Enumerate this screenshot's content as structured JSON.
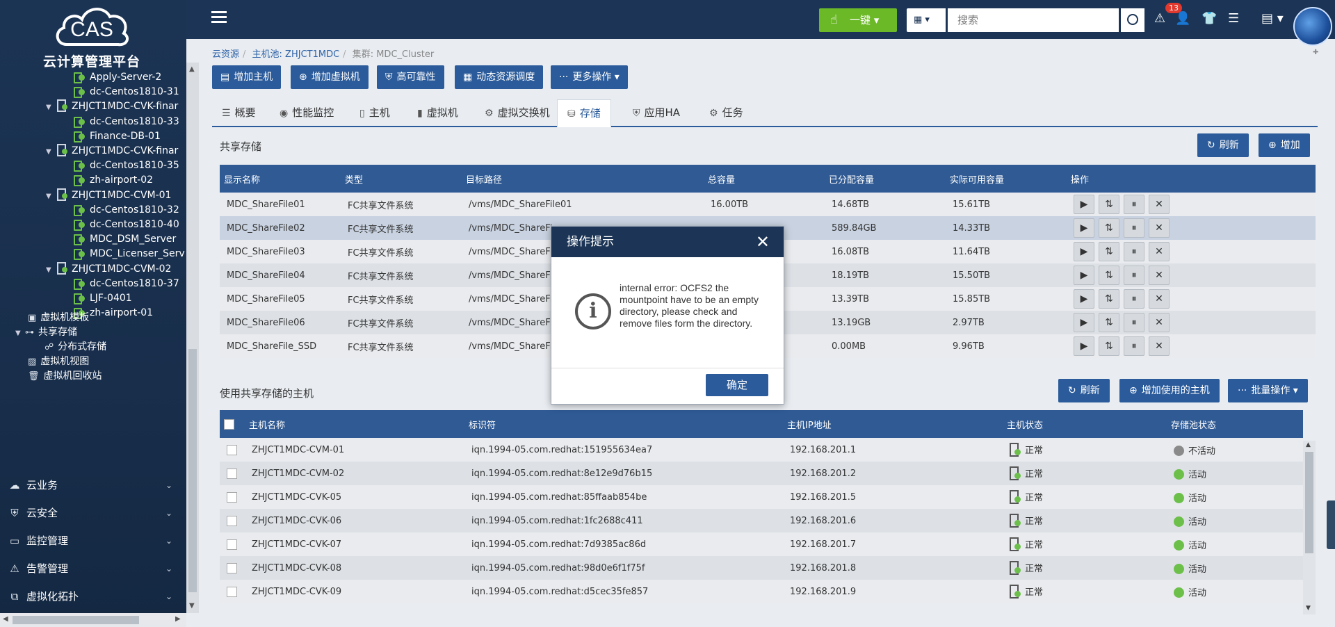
{
  "brand": {
    "logo_text": "CAS",
    "title": "云计算管理平台"
  },
  "tree": [
    {
      "label": "Apply-Server-2",
      "type": "vm",
      "indent": 2
    },
    {
      "label": "dc-Centos1810-31",
      "type": "vm",
      "indent": 2
    },
    {
      "label": "ZHJCT1MDC-CVK-finar",
      "type": "host",
      "indent": 1
    },
    {
      "label": "dc-Centos1810-33",
      "type": "vm",
      "indent": 2
    },
    {
      "label": "Finance-DB-01",
      "type": "vm",
      "indent": 2
    },
    {
      "label": "ZHJCT1MDC-CVK-finar",
      "type": "host",
      "indent": 1
    },
    {
      "label": "dc-Centos1810-35",
      "type": "vm",
      "indent": 2
    },
    {
      "label": "zh-airport-02",
      "type": "vm",
      "indent": 2
    },
    {
      "label": "ZHJCT1MDC-CVM-01",
      "type": "host",
      "indent": 1
    },
    {
      "label": "dc-Centos1810-32",
      "type": "vm",
      "indent": 2
    },
    {
      "label": "dc-Centos1810-40",
      "type": "vm",
      "indent": 2
    },
    {
      "label": "MDC_DSM_Server",
      "type": "vm",
      "indent": 2
    },
    {
      "label": "MDC_Licenser_Serv",
      "type": "vm",
      "indent": 2
    },
    {
      "label": "ZHJCT1MDC-CVM-02",
      "type": "host",
      "indent": 1
    },
    {
      "label": "dc-Centos1810-37",
      "type": "vm",
      "indent": 2
    },
    {
      "label": "LJF-0401",
      "type": "vm",
      "indent": 2
    },
    {
      "label": "zh-airport-01",
      "type": "vm",
      "indent": 2
    }
  ],
  "tree_misc": {
    "vm_template": "虚拟机模板",
    "shared_storage": "共享存储",
    "distributed_storage": "分布式存储",
    "vm_view": "虚拟机视图",
    "vm_recycle": "虚拟机回收站"
  },
  "nav": [
    {
      "label": "云业务",
      "icon": "cloud-icon"
    },
    {
      "label": "云安全",
      "icon": "shield-icon"
    },
    {
      "label": "监控管理",
      "icon": "monitor-icon"
    },
    {
      "label": "告警管理",
      "icon": "alarm-icon"
    },
    {
      "label": "虚拟化拓扑",
      "icon": "topology-icon"
    }
  ],
  "topbar": {
    "onekey": "一键",
    "search_placeholder": "搜索",
    "alert_count": "13"
  },
  "breadcrumb": {
    "root": "云资源",
    "pool": "主机池: ZHJCT1MDC",
    "cluster": "集群: MDC_Cluster"
  },
  "toolbar": {
    "add_host": "增加主机",
    "add_vm": "增加虚拟机",
    "ha": "高可靠性",
    "drs": "动态资源调度",
    "more": "更多操作"
  },
  "tabs": [
    {
      "label": "概要",
      "icon": "list-icon"
    },
    {
      "label": "性能监控",
      "icon": "gauge-icon"
    },
    {
      "label": "主机",
      "icon": "server-icon"
    },
    {
      "label": "虚拟机",
      "icon": "vm-icon"
    },
    {
      "label": "虚拟交换机",
      "icon": "switch-icon"
    },
    {
      "label": "存储",
      "icon": "database-icon"
    },
    {
      "label": "应用HA",
      "icon": "app-ha-icon"
    },
    {
      "label": "任务",
      "icon": "task-icon"
    }
  ],
  "shared": {
    "title": "共享存储",
    "refresh": "刷新",
    "add": "增加",
    "headers": [
      "显示名称",
      "类型",
      "目标路径",
      "总容量",
      "已分配容量",
      "实际可用容量",
      "操作"
    ],
    "rows": [
      [
        "MDC_ShareFile01",
        "FC共享文件系统",
        "/vms/MDC_ShareFile01",
        "16.00TB",
        "14.68TB",
        "15.61TB"
      ],
      [
        "MDC_ShareFile02",
        "FC共享文件系统",
        "/vms/MDC_ShareFi",
        "",
        "589.84GB",
        "14.33TB"
      ],
      [
        "MDC_ShareFile03",
        "FC共享文件系统",
        "/vms/MDC_ShareFi",
        "",
        "16.08TB",
        "11.64TB"
      ],
      [
        "MDC_ShareFile04",
        "FC共享文件系统",
        "/vms/MDC_ShareFi",
        "",
        "18.19TB",
        "15.50TB"
      ],
      [
        "MDC_ShareFile05",
        "FC共享文件系统",
        "/vms/MDC_ShareFi",
        "",
        "13.39TB",
        "15.85TB"
      ],
      [
        "MDC_ShareFile06",
        "FC共享文件系统",
        "/vms/MDC_ShareFi",
        "",
        "13.19GB",
        "2.97TB"
      ],
      [
        "MDC_ShareFile_SSD",
        "FC共享文件系统",
        "/vms/MDC_ShareFi",
        "",
        "0.00MB",
        "9.96TB"
      ]
    ]
  },
  "hosts": {
    "title": "使用共享存储的主机",
    "refresh": "刷新",
    "add_host": "增加使用的主机",
    "batch": "批量操作",
    "headers": [
      "主机名称",
      "标识符",
      "主机IP地址",
      "主机状态",
      "存储池状态"
    ],
    "rows": [
      [
        "ZHJCT1MDC-CVM-01",
        "iqn.1994-05.com.redhat:151955634ea7",
        "192.168.201.1",
        "正常",
        "不活动"
      ],
      [
        "ZHJCT1MDC-CVM-02",
        "iqn.1994-05.com.redhat:8e12e9d76b15",
        "192.168.201.2",
        "正常",
        "活动"
      ],
      [
        "ZHJCT1MDC-CVK-05",
        "iqn.1994-05.com.redhat:85ffaab854be",
        "192.168.201.5",
        "正常",
        "活动"
      ],
      [
        "ZHJCT1MDC-CVK-06",
        "iqn.1994-05.com.redhat:1fc2688c411",
        "192.168.201.6",
        "正常",
        "活动"
      ],
      [
        "ZHJCT1MDC-CVK-07",
        "iqn.1994-05.com.redhat:7d9385ac86d",
        "192.168.201.7",
        "正常",
        "活动"
      ],
      [
        "ZHJCT1MDC-CVK-08",
        "iqn.1994-05.com.redhat:98d0e6f1f75f",
        "192.168.201.8",
        "正常",
        "活动"
      ],
      [
        "ZHJCT1MDC-CVK-09",
        "iqn.1994-05.com.redhat:d5cec35fe857",
        "192.168.201.9",
        "正常",
        "活动"
      ]
    ],
    "status_colors": {
      "active": "#6cc04a",
      "inactive": "#8a8a8a"
    }
  },
  "dialog": {
    "title": "操作提示",
    "message": "internal error: OCFS2 the mountpoint have to be an empty directory, please check and remove files form the directory.",
    "ok": "确定"
  }
}
